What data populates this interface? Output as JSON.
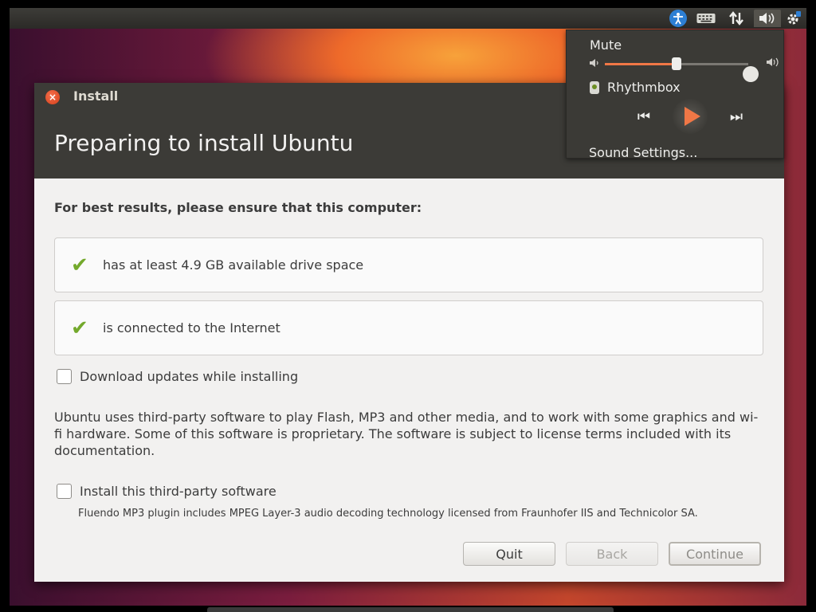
{
  "panel": {
    "icons": [
      "accessibility-icon",
      "keyboard-icon",
      "network-icon",
      "volume-icon",
      "settings-gear-icon"
    ]
  },
  "sound_menu": {
    "mute_label": "Mute",
    "volume_level": 0.5,
    "player_name": "Rhythmbox",
    "settings_label": "Sound Settings...",
    "accent_color": "#f07746"
  },
  "window": {
    "title": "Install",
    "heading": "Preparing to install Ubuntu"
  },
  "content": {
    "lead": "For best results, please ensure that this computer:",
    "requirements": [
      {
        "text": "has at least 4.9 GB available drive space",
        "met": true
      },
      {
        "text": "is connected to the Internet",
        "met": true
      }
    ],
    "download_updates_label": "Download updates while installing",
    "download_updates_checked": false,
    "third_party_paragraph": "Ubuntu uses third-party software to play Flash, MP3 and other media, and to work with some graphics and wi-fi hardware. Some of this software is proprietary. The software is subject to license terms included with its documentation.",
    "third_party_label": "Install this third-party software",
    "third_party_checked": false,
    "fluendo_note": "Fluendo MP3 plugin includes MPEG Layer-3 audio decoding technology licensed from Fraunhofer IIS and Technicolor SA."
  },
  "buttons": {
    "quit": "Quit",
    "back": "Back",
    "continue": "Continue"
  }
}
